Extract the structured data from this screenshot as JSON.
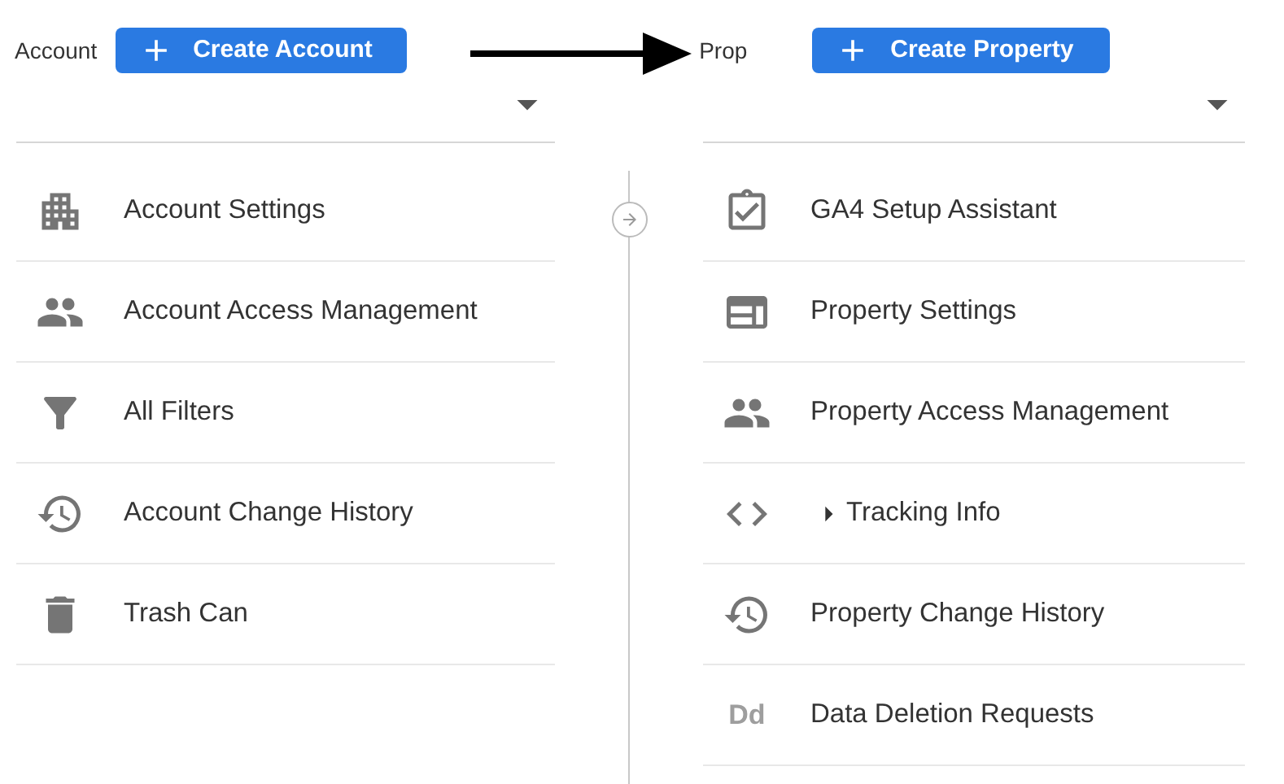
{
  "account": {
    "label": "Account",
    "create_button": "Create Account",
    "items": [
      {
        "kind": "building",
        "label": "Account Settings"
      },
      {
        "kind": "people",
        "label": "Account Access Management"
      },
      {
        "kind": "filter",
        "label": "All Filters"
      },
      {
        "kind": "history",
        "label": "Account Change History"
      },
      {
        "kind": "trash",
        "label": "Trash Can"
      }
    ]
  },
  "property": {
    "label": "Prop",
    "create_button": "Create Property",
    "items": [
      {
        "kind": "clipboard",
        "label": "GA4 Setup Assistant"
      },
      {
        "kind": "layout",
        "label": "Property Settings"
      },
      {
        "kind": "people",
        "label": "Property Access Management"
      },
      {
        "kind": "code",
        "label": "Tracking Info",
        "expanded": false
      },
      {
        "kind": "history",
        "label": "Property Change History"
      },
      {
        "kind": "letters",
        "icon_text": "Dd",
        "label": "Data Deletion Requests"
      }
    ]
  }
}
